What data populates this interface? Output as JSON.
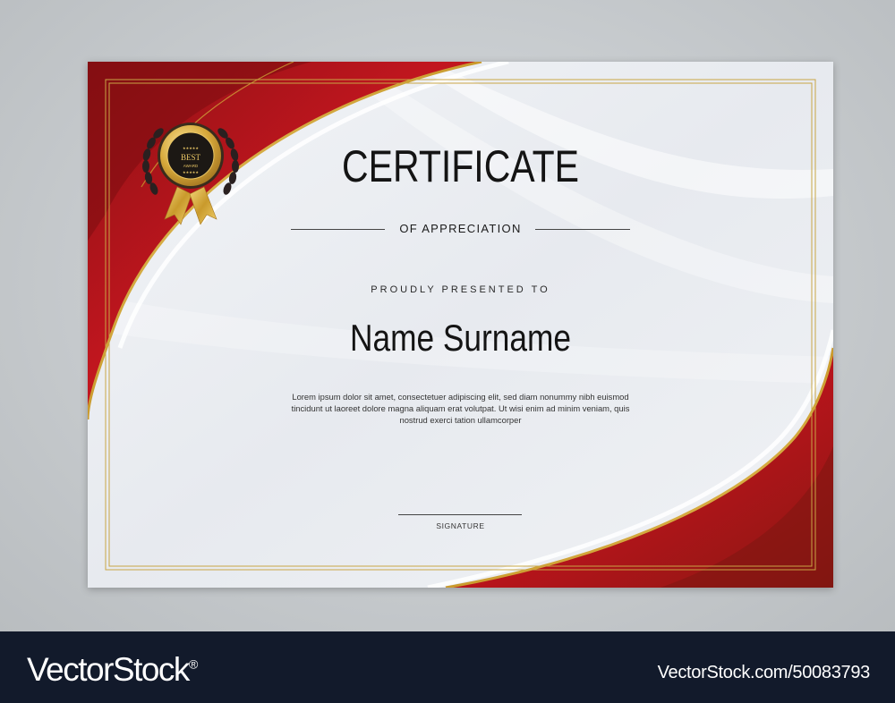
{
  "certificate": {
    "badge_top": "BEST",
    "badge_bottom": "AWARD",
    "badge_stars": "★★★★★",
    "title": "CERTIFICATE",
    "subtitle": "OF APPRECIATION",
    "presented": "PROUDLY PRESENTED TO",
    "name": "Name Surname",
    "body": "Lorem ipsum dolor sit amet, consectetuer adipiscing elit, sed diam nonummy nibh euismod tincidunt ut laoreet dolore magna aliquam erat volutpat. Ut wisi enim ad minim veniam, quis nostrud exerci tation ullamcorper",
    "signature_label": "SIGNATURE"
  },
  "footer": {
    "brand": "VectorStock",
    "registered": "®",
    "url": "VectorStock.com/50083793"
  },
  "colors": {
    "red": "#b8141c",
    "dark_red": "#7e0f12",
    "gold": "#d4a838",
    "footer_bg": "#121a2b"
  }
}
